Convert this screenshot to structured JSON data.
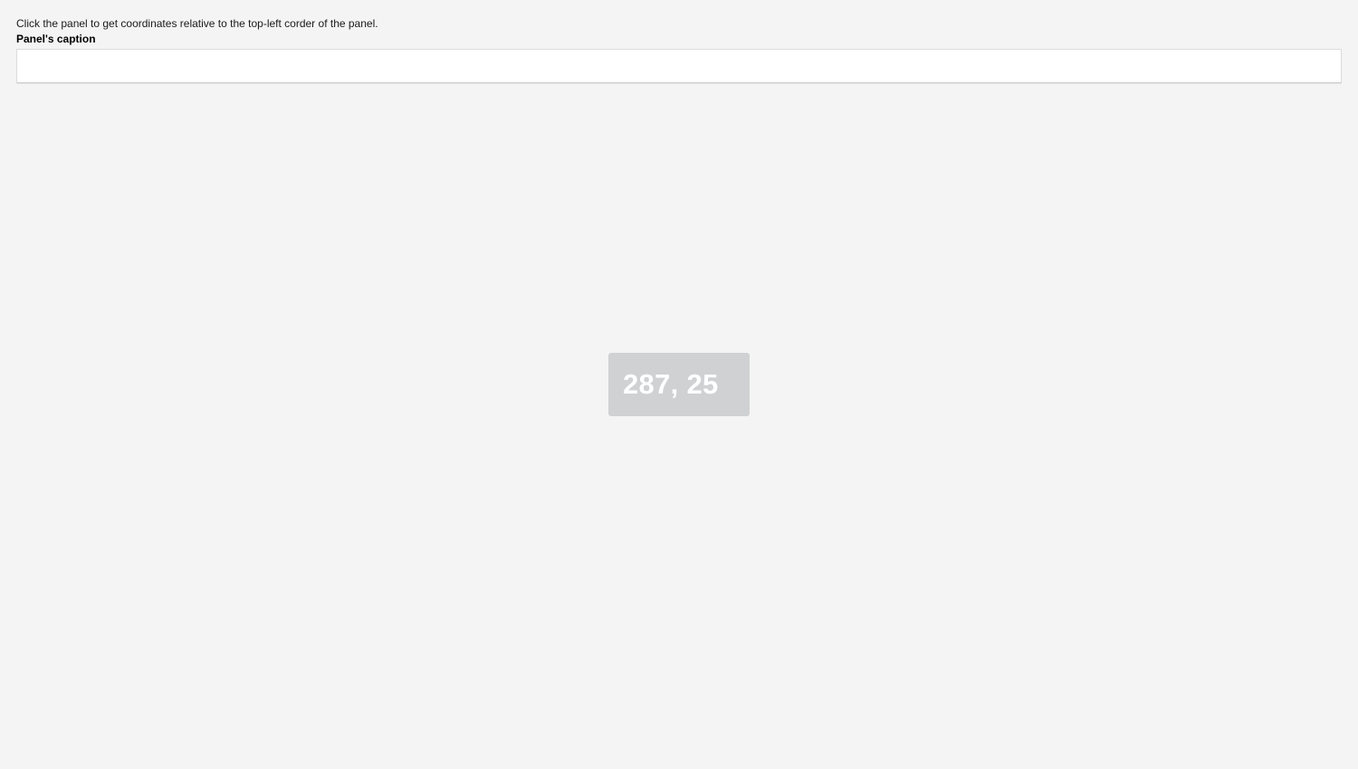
{
  "instructions": "Click the panel to get coordinates relative to the top-left corder of the panel.",
  "panel": {
    "caption": "Panel's caption"
  },
  "coordinates_toast": {
    "text": "287, 25"
  }
}
